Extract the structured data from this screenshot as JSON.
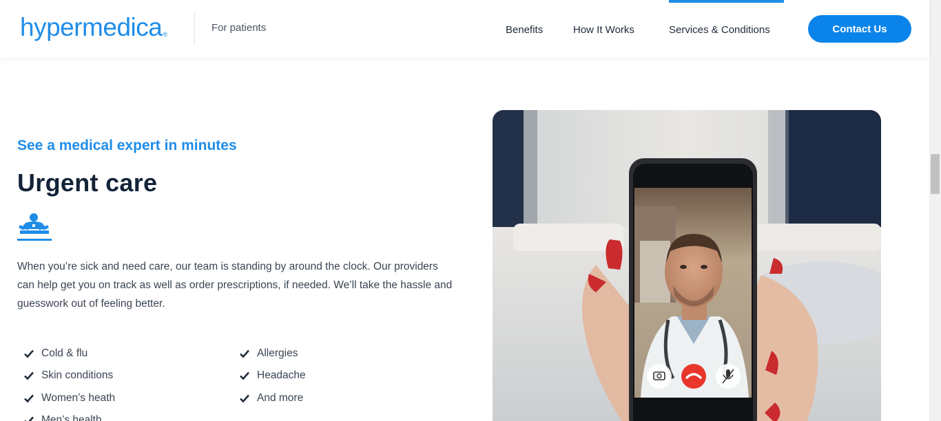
{
  "header": {
    "logo_text": "hypermedica",
    "logo_mark": "®",
    "tagline": "For patients",
    "nav": [
      {
        "label": "Benefits",
        "active": false
      },
      {
        "label": "How It Works",
        "active": false
      },
      {
        "label": "Services & Conditions",
        "active": true
      }
    ],
    "cta_label": "Contact Us"
  },
  "hero": {
    "eyebrow": "See a medical expert in minutes",
    "title": "Urgent care",
    "icon": "doctor-icon",
    "description": "When you’re sick and need care, our team is standing by around the clock. Our providers can help get you on track as well as order prescriptions, if needed. We’ll take the hassle and guesswork out of feeling better.",
    "conditions_col1": [
      "Cold & flu",
      "Skin conditions",
      "Women’s heath",
      "Men’s health"
    ],
    "conditions_col2": [
      "Allergies",
      "Headache",
      "And more"
    ],
    "photo": "doctor-video-call-photo"
  },
  "colors": {
    "brand_blue": "#1f8de8",
    "button_blue": "#0a84ea",
    "dark_text": "#132338",
    "body_text": "#3a4452",
    "end_call_red": "#e8362b"
  }
}
